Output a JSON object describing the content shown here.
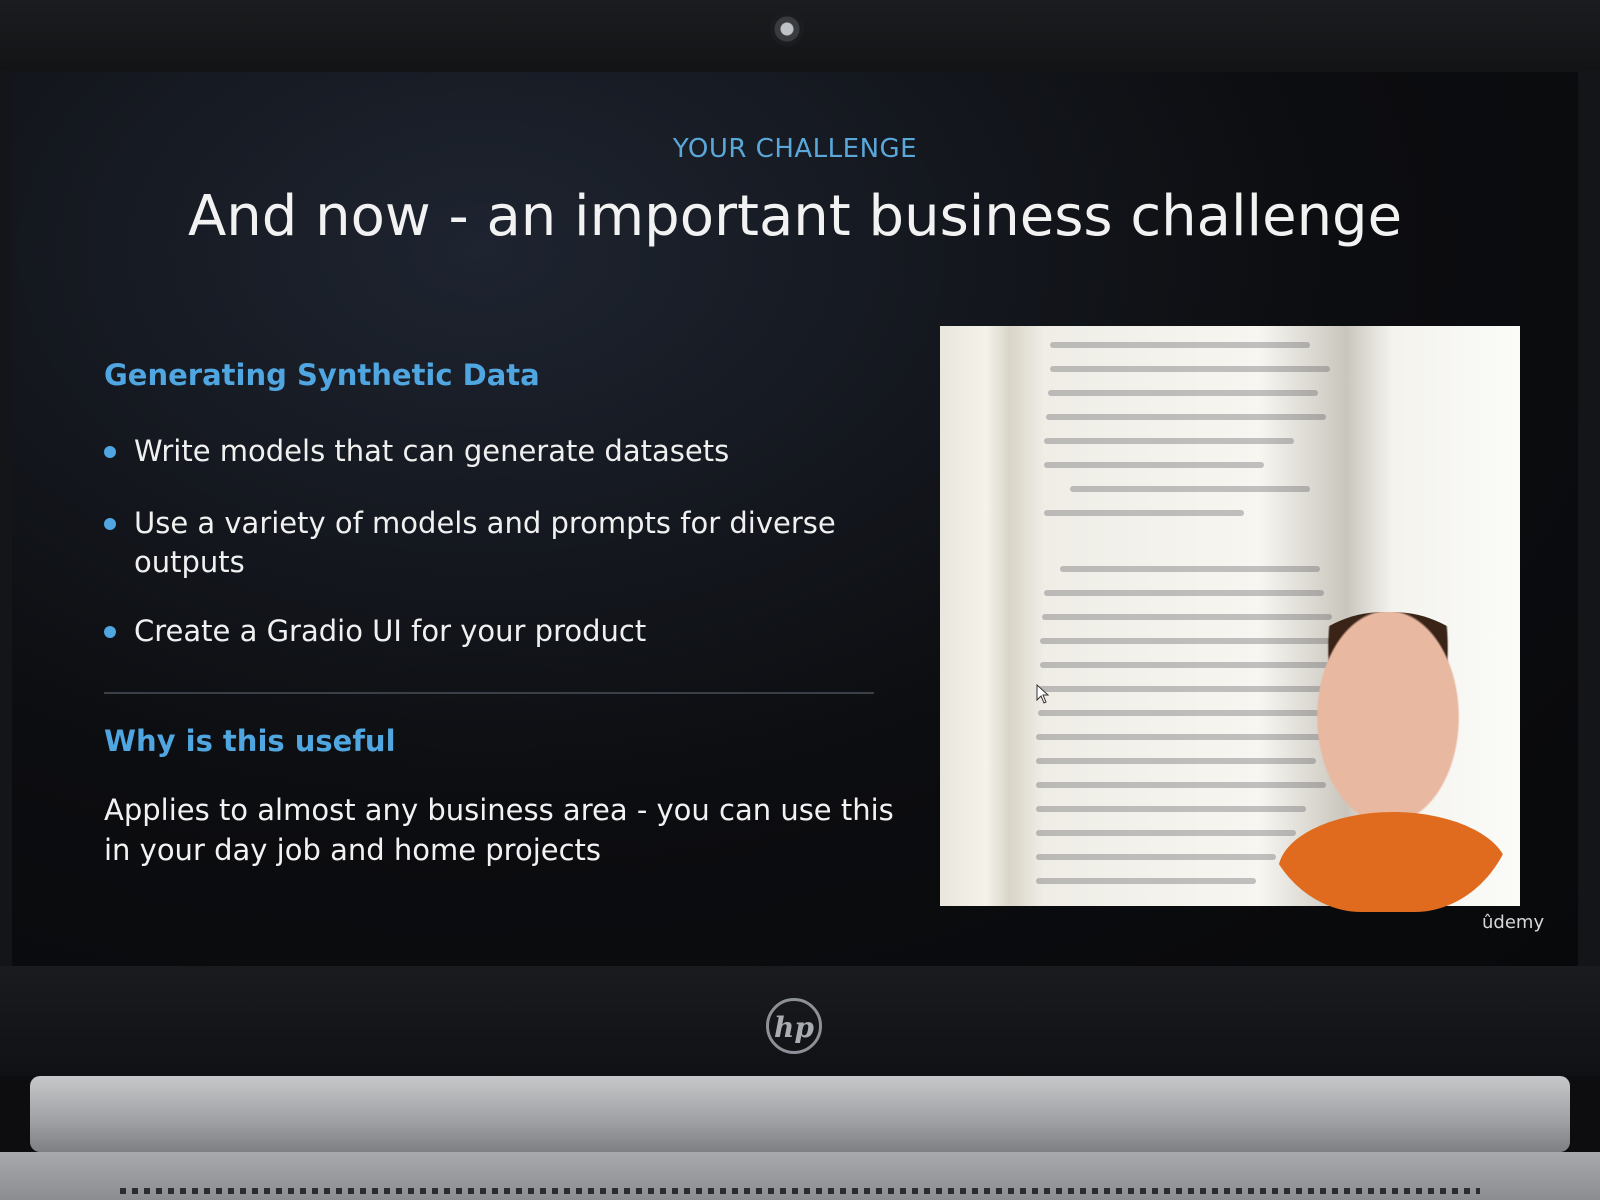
{
  "slide": {
    "kicker": "YOUR CHALLENGE",
    "title": "And now - an important business challenge",
    "section1": {
      "heading": "Generating Synthetic Data",
      "bullets": [
        "Write models that can generate datasets",
        "Use a variety of models and prompts for diverse outputs",
        "Create a Gradio UI for your product"
      ]
    },
    "section2": {
      "heading": "Why is this useful",
      "body": "Applies to almost any business area - you can use this in your day job and home projects"
    }
  },
  "branding": {
    "platform": "ûdemy",
    "laptop_logo": "hp"
  },
  "colors": {
    "accent": "#4fa6e0",
    "text": "#f2f2f2",
    "background": "#0c0d10",
    "shirt": "#e06b1f"
  },
  "icons": {
    "bullet": "bullet-dot-icon",
    "pointer": "mouse-pointer-icon"
  }
}
